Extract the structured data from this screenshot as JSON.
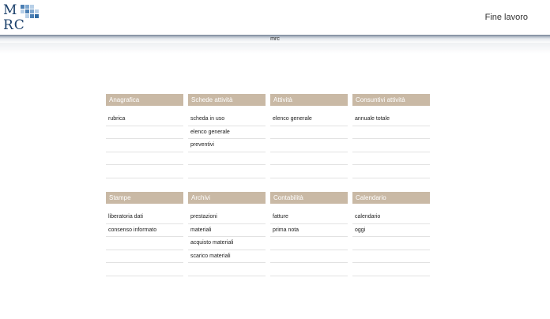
{
  "header": {
    "logo_top": "M",
    "logo_bottom": "RC",
    "logo_colors": [
      "#4b7fb4",
      "#7da6cf",
      "#b7cfe7",
      "#2e6aa3"
    ],
    "finish_label": "Fine lavoro",
    "bar_label": "mrc"
  },
  "panels": [
    {
      "title": "Anagrafica",
      "items": [
        "rubrica",
        "",
        "",
        "",
        ""
      ]
    },
    {
      "title": "Schede attività",
      "items": [
        "scheda in uso",
        "elenco generale",
        "preventivi",
        "",
        ""
      ]
    },
    {
      "title": "Attività",
      "items": [
        "elenco generale",
        "",
        "",
        "",
        ""
      ]
    },
    {
      "title": "Consuntivi attività",
      "items": [
        "annuale totale",
        "",
        "",
        "",
        ""
      ]
    },
    {
      "title": "Stampe",
      "items": [
        "liberatoria dati",
        "consenso informato",
        "",
        "",
        ""
      ]
    },
    {
      "title": "Archivi",
      "items": [
        "prestazioni",
        "materiali",
        "acquisto materiali",
        "scarico materiali",
        ""
      ]
    },
    {
      "title": "Contabilità",
      "items": [
        "fatture",
        "prima nota",
        "",
        "",
        ""
      ]
    },
    {
      "title": "Calendario",
      "items": [
        "calendario",
        "oggi",
        "",
        "",
        ""
      ]
    }
  ]
}
